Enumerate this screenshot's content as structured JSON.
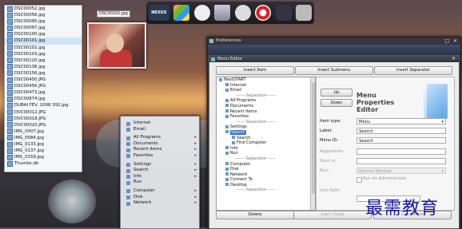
{
  "file_list": [
    "DSC00052.jpg",
    "DSC00056.jpg",
    "DSC00095.jpg",
    "DSC00097.jpg",
    "DSC00100.jpg",
    "DSC00101.jpg",
    "DSC00102.jpg",
    "DSC00103.jpg",
    "DSC00120.jpg",
    "DSC00138.jpg",
    "DSC00156.jpg",
    "DSC00450.JPG",
    "DSC00456.JPG",
    "DSC00473.jpg",
    "DSC00874.jpg",
    "DUBAI FEV. 2008 392.jpg",
    "DVC00012.JPG",
    "DVC00018.JPG",
    "DVC00020.JPG",
    "IMG_0007.jpg",
    "IMG_0084.jpg",
    "IMG_0133.jpg",
    "IMG_0137.jpg",
    "IMG_0159.jpg",
    "Thumbs.db"
  ],
  "selected_file_index": 5,
  "thumbnail_label": "DSC00101.jpg",
  "dock": {
    "items": [
      {
        "name": "nexus-logo",
        "label": "NEXUS"
      },
      {
        "name": "windows-icon",
        "label": ""
      },
      {
        "name": "clock-icon",
        "label": ""
      },
      {
        "name": "recycle-bin-icon",
        "label": ""
      },
      {
        "name": "media-player-icon",
        "label": ""
      },
      {
        "name": "ball-icon",
        "label": ""
      },
      {
        "name": "camera-icon",
        "label": ""
      },
      {
        "name": "settings-icon",
        "label": ""
      }
    ]
  },
  "start_menu": {
    "groups": [
      [
        {
          "label": "Internet",
          "arrow": false
        },
        {
          "label": "Email",
          "arrow": false
        }
      ],
      [
        {
          "label": "All Programs",
          "arrow": true
        },
        {
          "label": "Documents",
          "arrow": true
        },
        {
          "label": "Recent Items",
          "arrow": true
        },
        {
          "label": "Favorites",
          "arrow": true
        }
      ],
      [
        {
          "label": "Settings",
          "arrow": true
        },
        {
          "label": "Search",
          "arrow": true
        },
        {
          "label": "Info",
          "arrow": true
        },
        {
          "label": "Run",
          "arrow": false
        }
      ],
      [
        {
          "label": "Computer",
          "arrow": true
        },
        {
          "label": "Disk",
          "arrow": true
        },
        {
          "label": "Network",
          "arrow": true
        }
      ]
    ]
  },
  "prefs": {
    "title": "Preferences",
    "close": "✕",
    "minmax": "□"
  },
  "editor": {
    "title": "Menu Editor",
    "close": "✕",
    "insert_item": "Insert Item",
    "insert_submenu": "Insert Submenu",
    "insert_separator": "Insert Separator",
    "delete": "Delete",
    "cant_undo": "Can't Undo",
    "cant_redo": "Can't Redo",
    "tree": [
      {
        "label": "NextSTART",
        "indent": 0,
        "type": "root"
      },
      {
        "label": "Internet",
        "indent": 1,
        "type": "item"
      },
      {
        "label": "Email",
        "indent": 1,
        "type": "item"
      },
      {
        "label": "-------Separator-------",
        "indent": 1,
        "type": "sep"
      },
      {
        "label": "All Programs",
        "indent": 1,
        "type": "item"
      },
      {
        "label": "Documents",
        "indent": 1,
        "type": "item"
      },
      {
        "label": "Recent Items",
        "indent": 1,
        "type": "item"
      },
      {
        "label": "Favorites",
        "indent": 1,
        "type": "item"
      },
      {
        "label": "-------Separator-------",
        "indent": 1,
        "type": "sep"
      },
      {
        "label": "Settings",
        "indent": 1,
        "type": "item"
      },
      {
        "label": "Search",
        "indent": 1,
        "type": "selected"
      },
      {
        "label": "Search",
        "indent": 2,
        "type": "item"
      },
      {
        "label": "Find Computer",
        "indent": 2,
        "type": "item"
      },
      {
        "label": "Info",
        "indent": 1,
        "type": "item"
      },
      {
        "label": "Run",
        "indent": 1,
        "type": "item"
      },
      {
        "label": "-------Separator-------",
        "indent": 1,
        "type": "sep"
      },
      {
        "label": "Computer",
        "indent": 1,
        "type": "item"
      },
      {
        "label": "Disk",
        "indent": 1,
        "type": "item"
      },
      {
        "label": "Network",
        "indent": 1,
        "type": "item"
      },
      {
        "label": "Connect To",
        "indent": 1,
        "type": "item"
      },
      {
        "label": "Desktop",
        "indent": 1,
        "type": "item"
      },
      {
        "label": "-------Separator-------",
        "indent": 1,
        "type": "sep"
      }
    ],
    "up": "Up",
    "down": "Down",
    "props_title": "Menu Properties Editor",
    "fields": {
      "item_type_label": "Item type:",
      "item_type_value": "Menu",
      "label_label": "Label:",
      "label_value": "Search",
      "menu_id_label": "Menu ID:",
      "menu_id_value": "Search",
      "arguments_label": "Arguments:",
      "arguments_value": "",
      "start_in_label": "Start in:",
      "start_in_value": "",
      "run_label": "Run:",
      "run_value": "Normal Window",
      "run_as_admin": "Run As Administrator",
      "icon_path_label": "Icon Path:",
      "icon_path_value": ""
    }
  },
  "watermark": "最需教育"
}
